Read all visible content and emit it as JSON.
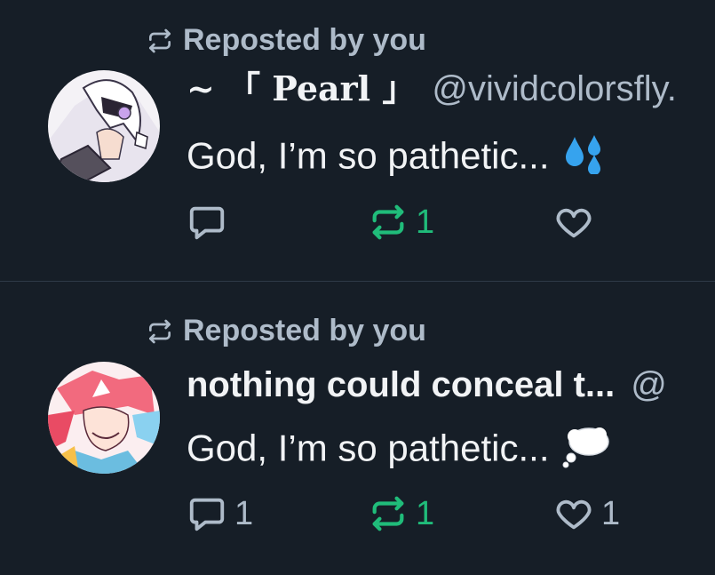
{
  "colors": {
    "background": "#161e27",
    "muted": "#aebbc9",
    "repost_active": "#20bc7a",
    "text": "#f1f3f5",
    "divider": "#2e3a47"
  },
  "posts": [
    {
      "repost_label": "Reposted by you",
      "display_name": "~ 「 Pearl 」",
      "handle": "@vividcolorsfly.",
      "text": "God, I’m so pathetic...",
      "emoji": "sweat-droplets",
      "reply_count": "",
      "repost_count": "1",
      "like_count": ""
    },
    {
      "repost_label": "Reposted by you",
      "display_name": "nothing could conceal t...",
      "handle": "@",
      "text": "God, I’m so pathetic...",
      "emoji": "thought-balloon",
      "reply_count": "1",
      "repost_count": "1",
      "like_count": "1"
    }
  ],
  "icons": {
    "repost_label": "repost-icon",
    "reply": "reply-icon",
    "repost": "repost-icon",
    "like": "heart-icon"
  }
}
